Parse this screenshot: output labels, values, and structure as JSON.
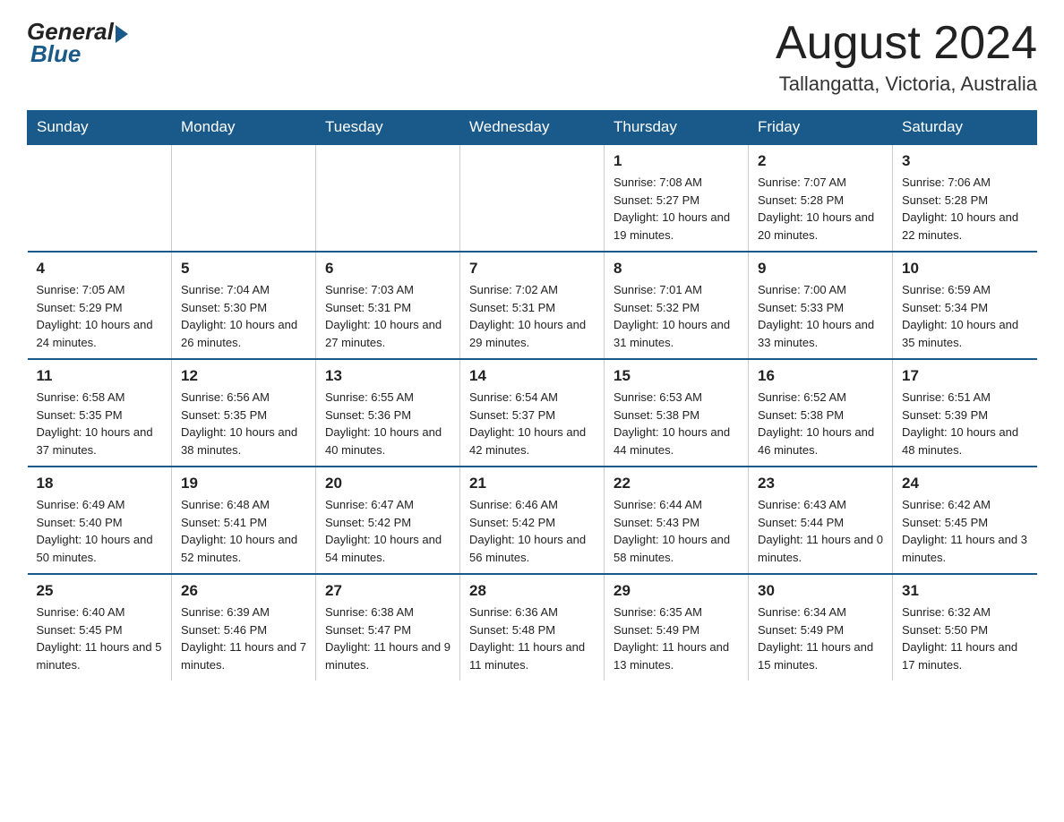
{
  "header": {
    "logo_general": "General",
    "logo_blue": "Blue",
    "month_title": "August 2024",
    "location": "Tallangatta, Victoria, Australia"
  },
  "days_of_week": [
    "Sunday",
    "Monday",
    "Tuesday",
    "Wednesday",
    "Thursday",
    "Friday",
    "Saturday"
  ],
  "weeks": [
    [
      {
        "day": "",
        "info": ""
      },
      {
        "day": "",
        "info": ""
      },
      {
        "day": "",
        "info": ""
      },
      {
        "day": "",
        "info": ""
      },
      {
        "day": "1",
        "info": "Sunrise: 7:08 AM\nSunset: 5:27 PM\nDaylight: 10 hours and 19 minutes."
      },
      {
        "day": "2",
        "info": "Sunrise: 7:07 AM\nSunset: 5:28 PM\nDaylight: 10 hours and 20 minutes."
      },
      {
        "day": "3",
        "info": "Sunrise: 7:06 AM\nSunset: 5:28 PM\nDaylight: 10 hours and 22 minutes."
      }
    ],
    [
      {
        "day": "4",
        "info": "Sunrise: 7:05 AM\nSunset: 5:29 PM\nDaylight: 10 hours and 24 minutes."
      },
      {
        "day": "5",
        "info": "Sunrise: 7:04 AM\nSunset: 5:30 PM\nDaylight: 10 hours and 26 minutes."
      },
      {
        "day": "6",
        "info": "Sunrise: 7:03 AM\nSunset: 5:31 PM\nDaylight: 10 hours and 27 minutes."
      },
      {
        "day": "7",
        "info": "Sunrise: 7:02 AM\nSunset: 5:31 PM\nDaylight: 10 hours and 29 minutes."
      },
      {
        "day": "8",
        "info": "Sunrise: 7:01 AM\nSunset: 5:32 PM\nDaylight: 10 hours and 31 minutes."
      },
      {
        "day": "9",
        "info": "Sunrise: 7:00 AM\nSunset: 5:33 PM\nDaylight: 10 hours and 33 minutes."
      },
      {
        "day": "10",
        "info": "Sunrise: 6:59 AM\nSunset: 5:34 PM\nDaylight: 10 hours and 35 minutes."
      }
    ],
    [
      {
        "day": "11",
        "info": "Sunrise: 6:58 AM\nSunset: 5:35 PM\nDaylight: 10 hours and 37 minutes."
      },
      {
        "day": "12",
        "info": "Sunrise: 6:56 AM\nSunset: 5:35 PM\nDaylight: 10 hours and 38 minutes."
      },
      {
        "day": "13",
        "info": "Sunrise: 6:55 AM\nSunset: 5:36 PM\nDaylight: 10 hours and 40 minutes."
      },
      {
        "day": "14",
        "info": "Sunrise: 6:54 AM\nSunset: 5:37 PM\nDaylight: 10 hours and 42 minutes."
      },
      {
        "day": "15",
        "info": "Sunrise: 6:53 AM\nSunset: 5:38 PM\nDaylight: 10 hours and 44 minutes."
      },
      {
        "day": "16",
        "info": "Sunrise: 6:52 AM\nSunset: 5:38 PM\nDaylight: 10 hours and 46 minutes."
      },
      {
        "day": "17",
        "info": "Sunrise: 6:51 AM\nSunset: 5:39 PM\nDaylight: 10 hours and 48 minutes."
      }
    ],
    [
      {
        "day": "18",
        "info": "Sunrise: 6:49 AM\nSunset: 5:40 PM\nDaylight: 10 hours and 50 minutes."
      },
      {
        "day": "19",
        "info": "Sunrise: 6:48 AM\nSunset: 5:41 PM\nDaylight: 10 hours and 52 minutes."
      },
      {
        "day": "20",
        "info": "Sunrise: 6:47 AM\nSunset: 5:42 PM\nDaylight: 10 hours and 54 minutes."
      },
      {
        "day": "21",
        "info": "Sunrise: 6:46 AM\nSunset: 5:42 PM\nDaylight: 10 hours and 56 minutes."
      },
      {
        "day": "22",
        "info": "Sunrise: 6:44 AM\nSunset: 5:43 PM\nDaylight: 10 hours and 58 minutes."
      },
      {
        "day": "23",
        "info": "Sunrise: 6:43 AM\nSunset: 5:44 PM\nDaylight: 11 hours and 0 minutes."
      },
      {
        "day": "24",
        "info": "Sunrise: 6:42 AM\nSunset: 5:45 PM\nDaylight: 11 hours and 3 minutes."
      }
    ],
    [
      {
        "day": "25",
        "info": "Sunrise: 6:40 AM\nSunset: 5:45 PM\nDaylight: 11 hours and 5 minutes."
      },
      {
        "day": "26",
        "info": "Sunrise: 6:39 AM\nSunset: 5:46 PM\nDaylight: 11 hours and 7 minutes."
      },
      {
        "day": "27",
        "info": "Sunrise: 6:38 AM\nSunset: 5:47 PM\nDaylight: 11 hours and 9 minutes."
      },
      {
        "day": "28",
        "info": "Sunrise: 6:36 AM\nSunset: 5:48 PM\nDaylight: 11 hours and 11 minutes."
      },
      {
        "day": "29",
        "info": "Sunrise: 6:35 AM\nSunset: 5:49 PM\nDaylight: 11 hours and 13 minutes."
      },
      {
        "day": "30",
        "info": "Sunrise: 6:34 AM\nSunset: 5:49 PM\nDaylight: 11 hours and 15 minutes."
      },
      {
        "day": "31",
        "info": "Sunrise: 6:32 AM\nSunset: 5:50 PM\nDaylight: 11 hours and 17 minutes."
      }
    ]
  ]
}
